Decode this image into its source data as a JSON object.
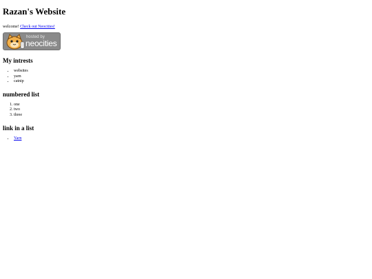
{
  "page": {
    "title": "Razan's Website",
    "welcome_text": "welcome!",
    "welcome_link": "Check out Neocities!"
  },
  "badge": {
    "line1": "hosted by",
    "line2": "neocities",
    "icon": "neocities-cat-icon"
  },
  "interests": {
    "heading": "My intrests",
    "items": [
      "websites",
      "yarn",
      "catnip"
    ]
  },
  "numbered": {
    "heading": "numbered list",
    "items": [
      "one",
      "two",
      "three"
    ]
  },
  "links": {
    "heading": "link in a list",
    "items": [
      "Yarn"
    ]
  }
}
